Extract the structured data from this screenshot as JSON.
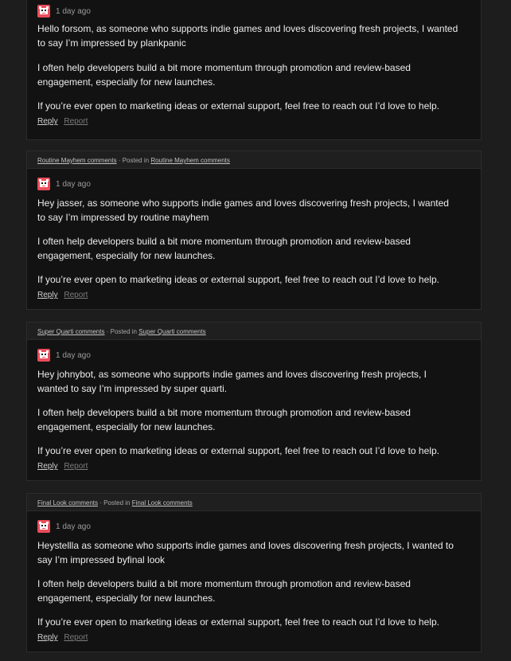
{
  "comments": [
    {
      "header": null,
      "time": "1 day ago",
      "paragraphs": [
        "Hello forsom, as someone who supports indie games and loves discovering fresh projects, I wanted to say I’m impressed by plankpanic",
        "I often help developers build a bit more momentum through promotion and review-based engagement, especially for new launches.",
        "If you’re ever open to marketing ideas or external support, feel free to reach out  I’d love to help."
      ],
      "reply": "Reply",
      "report": "Report"
    },
    {
      "header": {
        "link": "Routine Mayhem comments",
        "posted_in": "· Posted in",
        "target": "Routine Mayhem comments"
      },
      "time": "1 day ago",
      "paragraphs": [
        "Hey jasser, as someone who supports indie games and loves discovering fresh projects, I wanted to say I’m impressed by routine mayhem",
        "I often help developers build a bit more momentum through promotion and review-based engagement, especially for new launches.",
        "If you’re ever open to marketing ideas or external support, feel free to reach out  I’d love to help."
      ],
      "reply": "Reply",
      "report": "Report"
    },
    {
      "header": {
        "link": "Super Quarti comments",
        "posted_in": "· Posted in",
        "target": "Super Quarti comments"
      },
      "time": "1 day ago",
      "paragraphs": [
        "Hey johnybot, as someone who supports indie games and loves discovering fresh projects, I wanted to say I’m impressed by super quarti.",
        "I often help developers build a bit more momentum through promotion and review-based engagement, especially for new launches.",
        "If you’re ever open to marketing ideas or external support, feel free to reach out  I’d love to help."
      ],
      "reply": "Reply",
      "report": "Report"
    },
    {
      "header": {
        "link": "Final Look comments",
        "posted_in": "· Posted in",
        "target": "Final Look comments"
      },
      "time": "1 day ago",
      "paragraphs": [
        "Heystellla as someone who supports indie games and loves discovering fresh projects, I wanted to say I’m impressed byfinal look",
        "I often help developers build a bit more momentum through promotion and review-based engagement, especially for new launches.",
        "If you’re ever open to marketing ideas or external support, feel free to reach out  I’d love to help."
      ],
      "reply": "Reply",
      "report": "Report"
    }
  ],
  "avatar_icon": "pixel-creature-avatar-icon",
  "colors": {
    "avatar": "#ea4c5a",
    "card_bg": "#121212",
    "page_bg": "#1d1d1d"
  }
}
